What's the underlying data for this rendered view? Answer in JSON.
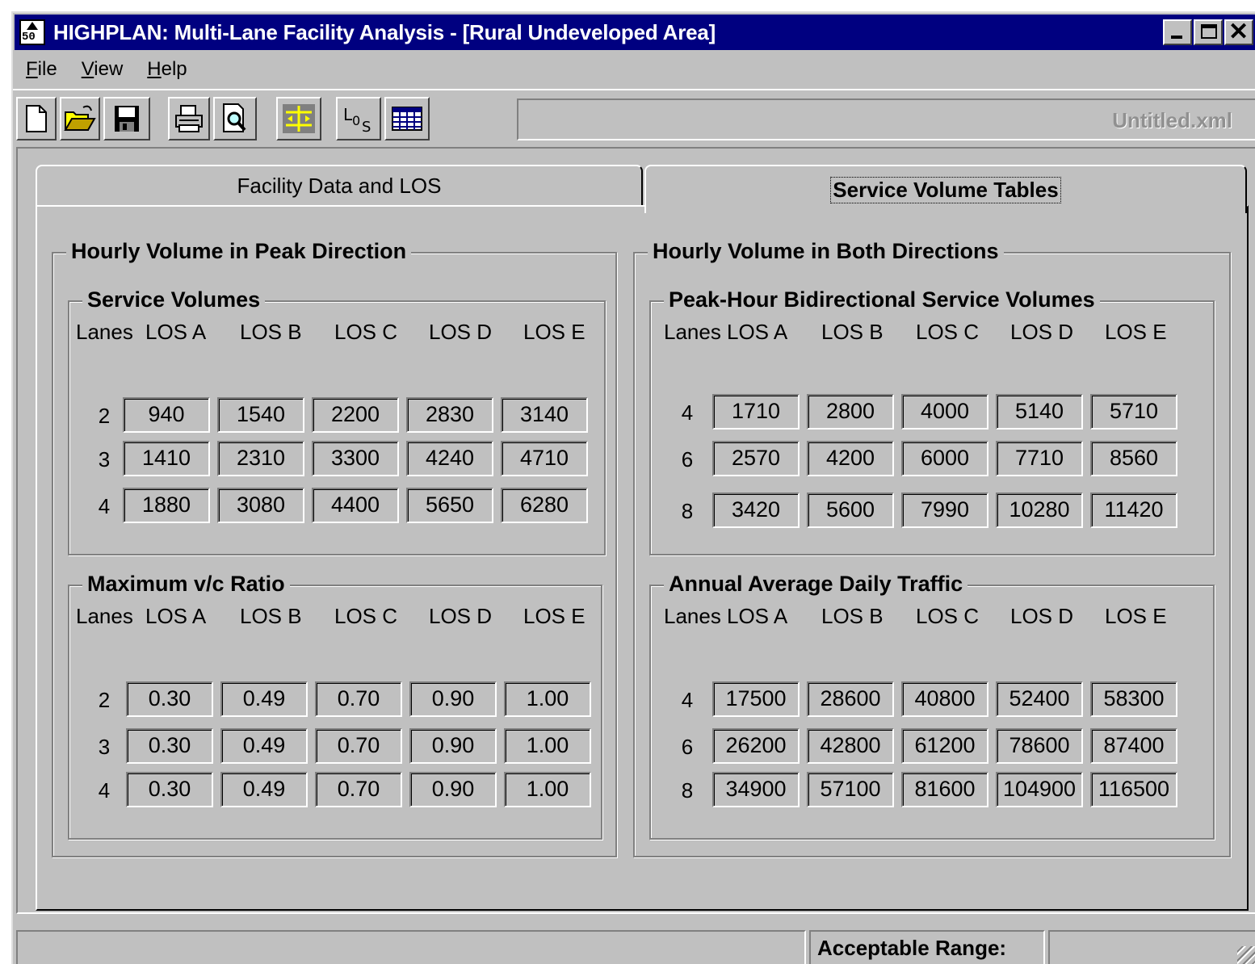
{
  "window": {
    "title": "HIGHPLAN: Multi-Lane Facility Analysis - [Rural Undeveloped Area]",
    "app_icon_label": "50",
    "controls": [
      "minimize-icon",
      "maximize-icon",
      "close-icon"
    ]
  },
  "menu": [
    "File",
    "View",
    "Help"
  ],
  "toolbar": {
    "icons": [
      "new-file-icon",
      "open-folder-icon",
      "save-disk-icon",
      "print-icon",
      "print-preview-icon",
      "arrange-icon",
      "los-icon",
      "table-icon"
    ],
    "filename": "Untitled.xml"
  },
  "tabs": {
    "inactive": "Facility Data and LOS",
    "active": "Service Volume Tables"
  },
  "left_section": {
    "title": "Hourly Volume in Peak Direction",
    "service_volumes": {
      "title": "Service Volumes",
      "lanes_header": "Lanes",
      "columns": [
        "LOS A",
        "LOS B",
        "LOS C",
        "LOS D",
        "LOS E"
      ],
      "rows": [
        {
          "lanes": "2",
          "values": [
            "940",
            "1540",
            "2200",
            "2830",
            "3140"
          ]
        },
        {
          "lanes": "3",
          "values": [
            "1410",
            "2310",
            "3300",
            "4240",
            "4710"
          ]
        },
        {
          "lanes": "4",
          "values": [
            "1880",
            "3080",
            "4400",
            "5650",
            "6280"
          ]
        }
      ]
    },
    "max_vc": {
      "title": "Maximum v/c Ratio",
      "lanes_header": "Lanes",
      "columns": [
        "LOS A",
        "LOS B",
        "LOS C",
        "LOS D",
        "LOS E"
      ],
      "rows": [
        {
          "lanes": "2",
          "values": [
            "0.30",
            "0.49",
            "0.70",
            "0.90",
            "1.00"
          ]
        },
        {
          "lanes": "3",
          "values": [
            "0.30",
            "0.49",
            "0.70",
            "0.90",
            "1.00"
          ]
        },
        {
          "lanes": "4",
          "values": [
            "0.30",
            "0.49",
            "0.70",
            "0.90",
            "1.00"
          ]
        }
      ]
    }
  },
  "right_section": {
    "title": "Hourly Volume in Both Directions",
    "bidirectional": {
      "title": "Peak-Hour Bidirectional Service Volumes",
      "lanes_header": "Lanes",
      "columns": [
        "LOS A",
        "LOS B",
        "LOS C",
        "LOS D",
        "LOS E"
      ],
      "rows": [
        {
          "lanes": "4",
          "values": [
            "1710",
            "2800",
            "4000",
            "5140",
            "5710"
          ]
        },
        {
          "lanes": "6",
          "values": [
            "2570",
            "4200",
            "6000",
            "7710",
            "8560"
          ]
        },
        {
          "lanes": "8",
          "values": [
            "3420",
            "5600",
            "7990",
            "10280",
            "11420"
          ]
        }
      ]
    },
    "aadt": {
      "title": "Annual Average Daily Traffic",
      "lanes_header": "Lanes",
      "columns": [
        "LOS A",
        "LOS B",
        "LOS C",
        "LOS D",
        "LOS E"
      ],
      "rows": [
        {
          "lanes": "4",
          "values": [
            "17500",
            "28600",
            "40800",
            "52400",
            "58300"
          ]
        },
        {
          "lanes": "6",
          "values": [
            "26200",
            "42800",
            "61200",
            "78600",
            "87400"
          ]
        },
        {
          "lanes": "8",
          "values": [
            "34900",
            "57100",
            "81600",
            "104900",
            "116500"
          ]
        }
      ]
    }
  },
  "status": {
    "acceptable_range_label": "Acceptable Range:",
    "acceptable_range_value": ""
  }
}
